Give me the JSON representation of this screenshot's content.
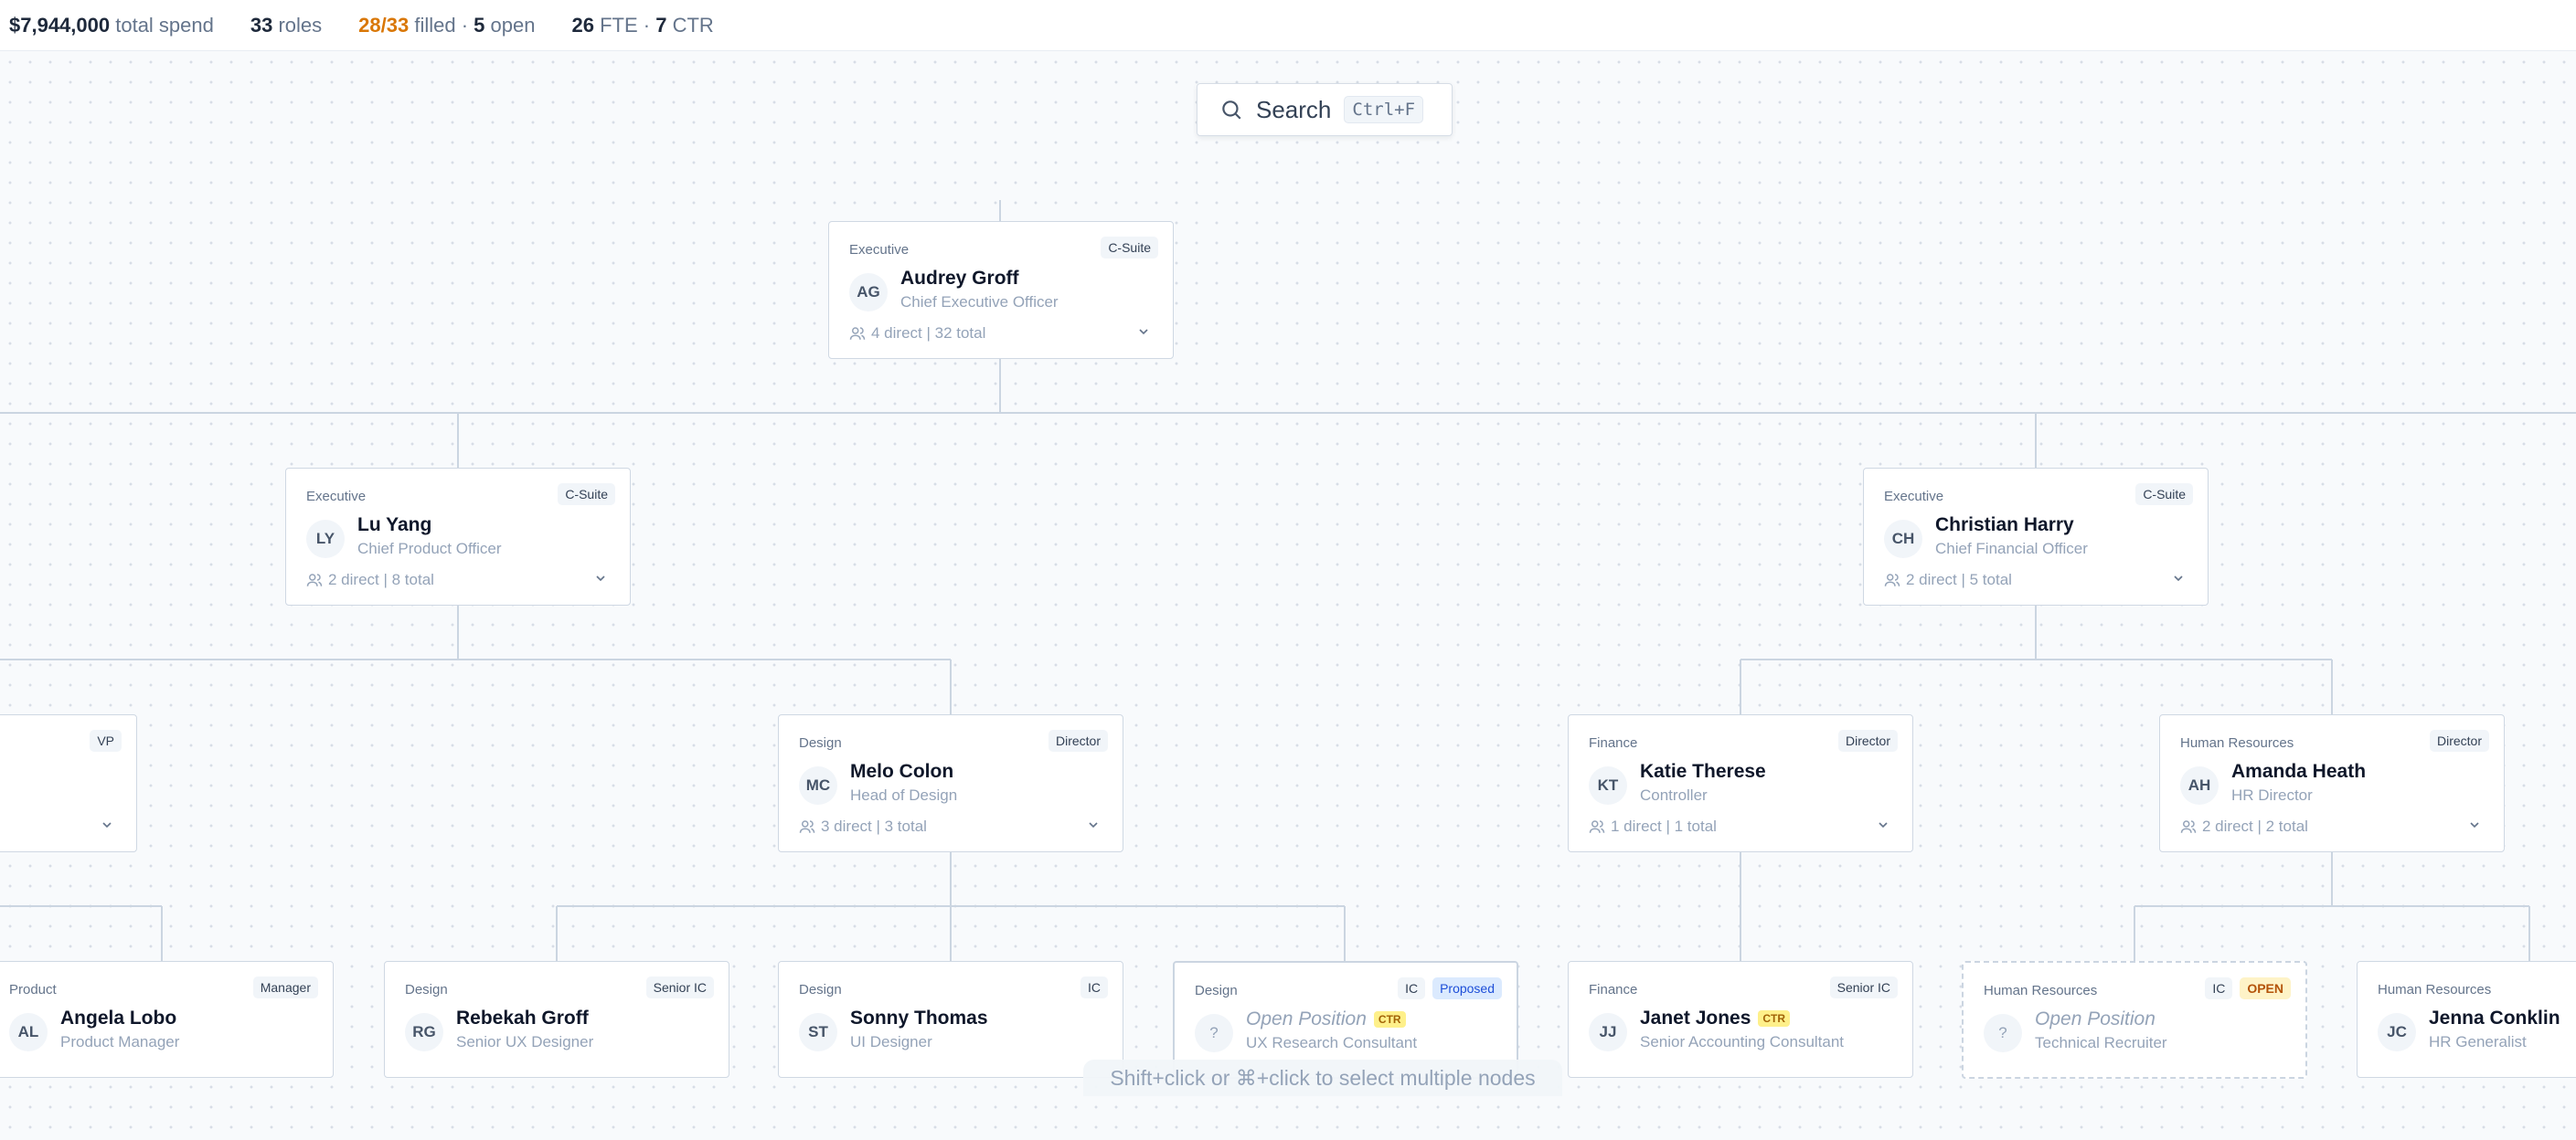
{
  "topbar": {
    "spend_value": "$7,944,000",
    "spend_label": "total spend",
    "roles_value": "33",
    "roles_label": "roles",
    "filled_value": "28/33",
    "filled_label": "filled ·",
    "open_value": "5",
    "open_label": "open",
    "fte_value": "26",
    "fte_label": "FTE ·",
    "ctr_value": "7",
    "ctr_label": "CTR"
  },
  "search": {
    "label": "Search",
    "shortcut": "Ctrl+F",
    "icon": "search-icon"
  },
  "hint": "Shift+click or ⌘+click to select multiple nodes",
  "colors": {
    "accent_amber": "#d97706",
    "connector": "#cbd5e1",
    "proposed_blue": "#1d4ed8",
    "open_yellow": "#fef3c7"
  },
  "nodes": {
    "ceo": {
      "dept": "Executive",
      "badge": "C-Suite",
      "initials": "AG",
      "name": "Audrey Groff",
      "title": "Chief Executive Officer",
      "meta": "4 direct | 32 total"
    },
    "cpo": {
      "dept": "Executive",
      "badge": "C-Suite",
      "initials": "LY",
      "name": "Lu Yang",
      "title": "Chief Product Officer",
      "meta": "2 direct | 8 total"
    },
    "cfo": {
      "dept": "Executive",
      "badge": "C-Suite",
      "initials": "CH",
      "name": "Christian Harry",
      "title": "Chief Financial Officer",
      "meta": "2 direct | 5 total"
    },
    "vp": {
      "badge": "VP"
    },
    "design_head": {
      "dept": "Design",
      "badge": "Director",
      "initials": "MC",
      "name": "Melo Colon",
      "title": "Head of Design",
      "meta": "3 direct | 3 total"
    },
    "controller": {
      "dept": "Finance",
      "badge": "Director",
      "initials": "KT",
      "name": "Katie Therese",
      "title": "Controller",
      "meta": "1 direct | 1 total"
    },
    "hr_director": {
      "dept": "Human Resources",
      "badge": "Director",
      "initials": "AH",
      "name": "Amanda Heath",
      "title": "HR Director",
      "meta": "2 direct | 2 total"
    },
    "pm": {
      "dept": "Product",
      "badge": "Manager",
      "initials": "AL",
      "name": "Angela Lobo",
      "title": "Product Manager"
    },
    "ux": {
      "dept": "Design",
      "badge": "Senior IC",
      "initials": "RG",
      "name": "Rebekah Groff",
      "title": "Senior UX Designer"
    },
    "ui": {
      "dept": "Design",
      "badge": "IC",
      "initials": "ST",
      "name": "Sonny Thomas",
      "title": "UI Designer"
    },
    "uxr": {
      "dept": "Design",
      "badge": "IC",
      "badge2": "Proposed",
      "initials": "?",
      "name": "Open Position",
      "ctr": "CTR",
      "title": "UX Research Consultant"
    },
    "accounting": {
      "dept": "Finance",
      "badge": "Senior IC",
      "initials": "JJ",
      "name": "Janet Jones",
      "ctr": "CTR",
      "title": "Senior Accounting Consultant"
    },
    "recruiter": {
      "dept": "Human Resources",
      "badge": "IC",
      "badge2": "OPEN",
      "initials": "?",
      "name": "Open Position",
      "title": "Technical Recruiter"
    },
    "generalist": {
      "dept": "Human Resources",
      "initials": "JC",
      "name": "Jenna Conklin",
      "title": "HR Generalist"
    }
  }
}
